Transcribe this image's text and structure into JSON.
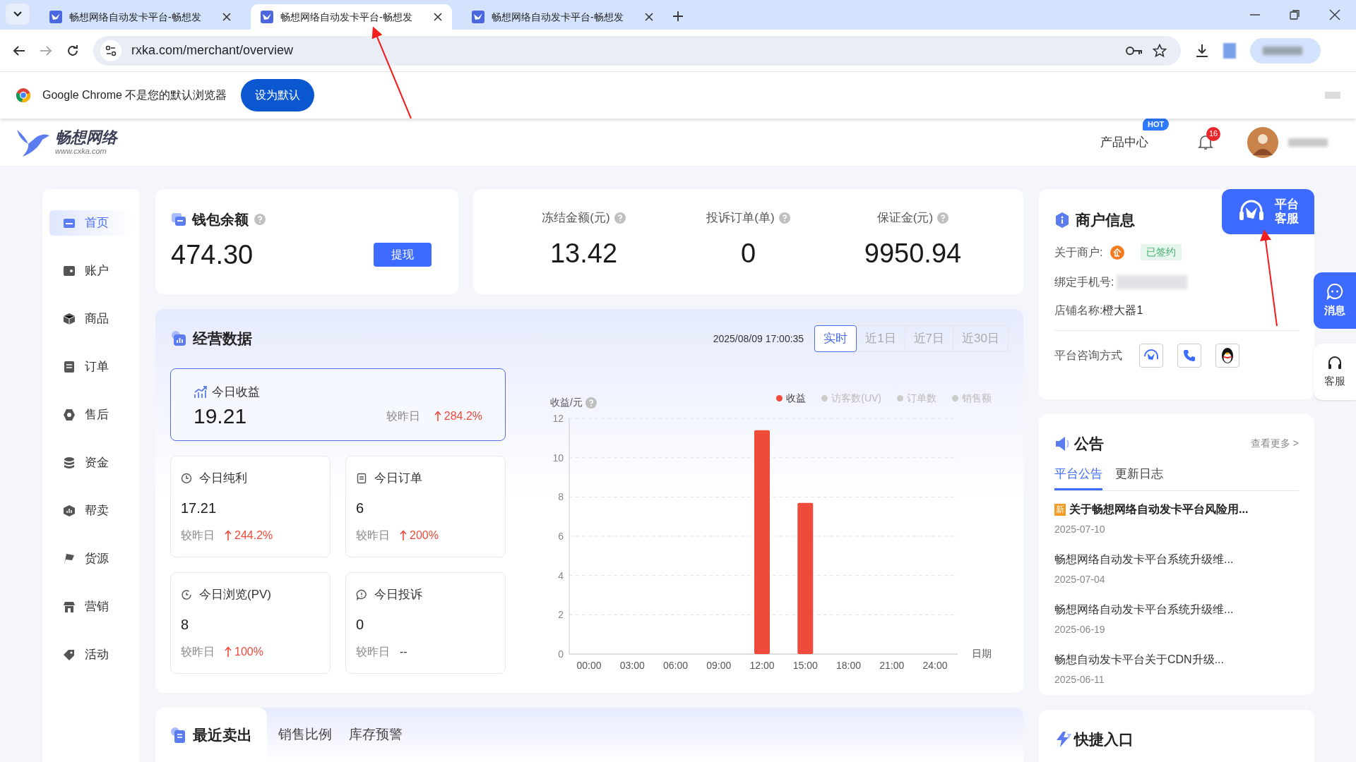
{
  "browser": {
    "tabs": [
      {
        "title": "畅想网络自动发卡平台-畅想发",
        "selected": false
      },
      {
        "title": "畅想网络自动发卡平台-畅想发",
        "selected": true
      },
      {
        "title": "畅想网络自动发卡平台-畅想发",
        "selected": false
      }
    ],
    "url": "rxka.com/merchant/overview",
    "infobar": {
      "message": "Google Chrome 不是您的默认浏览器",
      "button": "设为默认"
    }
  },
  "header": {
    "logo_name": "畅想网络",
    "logo_url": "www.cxka.com",
    "product_center": "产品中心",
    "hot_badge": "HOT",
    "notification_count": "16"
  },
  "sidebar": {
    "items": [
      {
        "label": "首页",
        "selected": true
      },
      {
        "label": "账户",
        "selected": false
      },
      {
        "label": "商品",
        "selected": false
      },
      {
        "label": "订单",
        "selected": false
      },
      {
        "label": "售后",
        "selected": false
      },
      {
        "label": "资金",
        "selected": false
      },
      {
        "label": "帮卖",
        "selected": false
      },
      {
        "label": "货源",
        "selected": false
      },
      {
        "label": "营销",
        "selected": false
      },
      {
        "label": "活动",
        "selected": false
      }
    ]
  },
  "wallet": {
    "title": "钱包余额",
    "amount": "474.30",
    "button": "提现"
  },
  "stats": [
    {
      "label": "冻结金额(元)",
      "value": "13.42"
    },
    {
      "label": "投诉订单(单)",
      "value": "0"
    },
    {
      "label": "保证金(元)",
      "value": "9950.94"
    }
  ],
  "business": {
    "title": "经营数据",
    "timestamp": "2025/08/09 17:00:35",
    "ranges": [
      {
        "label": "实时",
        "selected": true
      },
      {
        "label": "近1日",
        "selected": false
      },
      {
        "label": "近7日",
        "selected": false
      },
      {
        "label": "近30日",
        "selected": false
      }
    ],
    "highlight": {
      "label": "今日收益",
      "value": "19.21",
      "compare": "较昨日",
      "change": "284.2%"
    },
    "tiles": [
      {
        "label": "今日纯利",
        "value": "17.21",
        "compare": "较昨日",
        "change": "244.2%",
        "arrow_up": true
      },
      {
        "label": "今日订单",
        "value": "6",
        "compare": "较昨日",
        "change": "200%",
        "arrow_up": true
      },
      {
        "label": "今日浏览(PV)",
        "value": "8",
        "compare": "较昨日",
        "change": "100%",
        "arrow_up": true
      },
      {
        "label": "今日投诉",
        "value": "0",
        "compare": "较昨日",
        "change": "--",
        "arrow_up": false
      }
    ],
    "legend": [
      {
        "label": "访客数(UV)",
        "on": false
      },
      {
        "label": "订单数",
        "on": false
      },
      {
        "label": "销售额",
        "on": false
      }
    ],
    "chart_data": {
      "type": "bar",
      "xlabel": "日期",
      "ylabel": "收益/元",
      "categories": [
        "00:00",
        "03:00",
        "06:00",
        "09:00",
        "12:00",
        "15:00",
        "18:00",
        "21:00",
        "24:00"
      ],
      "series": [
        {
          "name": "收益",
          "color": "#ee4b3b",
          "values": [
            0,
            0,
            0,
            0,
            11.4,
            7.7,
            0,
            0,
            0
          ]
        }
      ],
      "ylim": [
        0,
        12
      ],
      "yticks": [
        0,
        2,
        4,
        6,
        8,
        10,
        12
      ],
      "grid": true
    }
  },
  "recent": {
    "tabs": [
      {
        "label": "最近卖出",
        "selected": true
      },
      {
        "label": "销售比例",
        "selected": false
      },
      {
        "label": "库存预警",
        "selected": false
      }
    ]
  },
  "merchant": {
    "title": "商户信息",
    "service_button": "平台客服",
    "about_label": "关于商户:",
    "status": "已签约",
    "phone_label": "绑定手机号:",
    "store_label": "店铺名称:",
    "store_name": "橙大器1",
    "contact_label": "平台咨询方式"
  },
  "notices": {
    "title": "公告",
    "more": "查看更多 >",
    "tabs": [
      {
        "label": "平台公告",
        "selected": true
      },
      {
        "label": "更新日志",
        "selected": false
      }
    ],
    "items": [
      {
        "badge": "新",
        "title": "关于畅想网络自动发卡平台风险用...",
        "date": "2025-07-10"
      },
      {
        "title": "畅想网络自动发卡平台系统升级维...",
        "date": "2025-07-04"
      },
      {
        "title": "畅想网络自动发卡平台系统升级维...",
        "date": "2025-06-19"
      },
      {
        "title": "畅想自动发卡平台关于CDN升级...",
        "date": "2025-06-11"
      }
    ]
  },
  "shortcuts": {
    "title": "快捷入口"
  },
  "floating": [
    {
      "label": "消息",
      "kind": "primary"
    },
    {
      "label": "客服",
      "kind": "plain"
    }
  ]
}
